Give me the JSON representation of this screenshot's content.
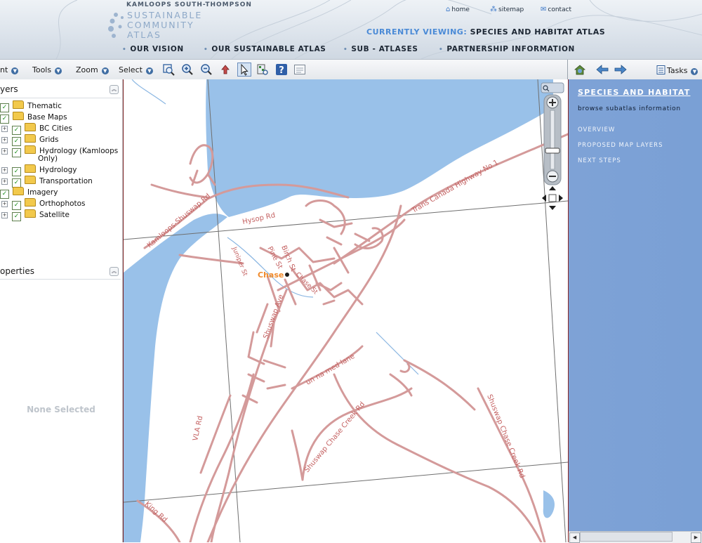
{
  "header": {
    "org": "KAMLOOPS SOUTH-THOMPSON",
    "logo_lines": [
      "SUSTAINABLE",
      "COMMUNITY",
      "ATLAS"
    ],
    "utility_links": [
      {
        "label": "home",
        "icon": "home-icon"
      },
      {
        "label": "sitemap",
        "icon": "sitemap-icon"
      },
      {
        "label": "contact",
        "icon": "envelope-icon"
      }
    ],
    "currently_viewing_label": "CURRENTLY VIEWING:",
    "currently_viewing_value": "SPECIES AND HABITAT ATLAS",
    "nav": [
      "OUR VISION",
      "OUR SUSTAINABLE ATLAS",
      "SUB - ATLASES",
      "PARTNERSHIP INFORMATION"
    ]
  },
  "toolbar": {
    "menus": [
      "nt",
      "Tools",
      "Zoom",
      "Select"
    ],
    "tools": [
      "zoom-to-extent-icon",
      "zoom-in-icon",
      "zoom-out-icon",
      "pan-icon",
      "select-pointer-icon",
      "identify-icon",
      "help-icon",
      "legend-icon"
    ],
    "right_tools": [
      "full-extent-icon",
      "back-arrow-icon",
      "forward-arrow-icon"
    ],
    "tasks_label": "Tasks"
  },
  "layers_panel": {
    "title": "yers",
    "tree": [
      {
        "label": "Thematic",
        "checked": true,
        "expandable": false
      },
      {
        "label": "Base Maps",
        "checked": true,
        "expandable": false
      },
      {
        "label": "BC Cities",
        "checked": true,
        "expandable": true
      },
      {
        "label": "Grids",
        "checked": true,
        "expandable": true
      },
      {
        "label": "Hydrology (Kamloops",
        "label2": "Only)",
        "checked": true,
        "expandable": true
      },
      {
        "label": "Hydrology",
        "checked": true,
        "expandable": true
      },
      {
        "label": "Transportation",
        "checked": true,
        "expandable": true
      },
      {
        "label": "Imagery",
        "checked": true,
        "expandable": false
      },
      {
        "label": "Orthophotos",
        "checked": true,
        "expandable": true
      },
      {
        "label": "Satellite",
        "checked": true,
        "expandable": true
      }
    ]
  },
  "properties_panel": {
    "title": "operties",
    "empty_text": "None Selected"
  },
  "map": {
    "place_label": "Chase",
    "road_labels": [
      "Trans Canada Highway No 1",
      "Kamloops-Shuswap Rd",
      "Hysop Rd",
      "Pine St",
      "Birch St",
      "Shuswap Ave",
      "Shuswap Chase Creek Rd",
      "Shuswap Chase Creek Rd",
      "un na med lane",
      "VLA Rd",
      "King Rd",
      "Juniper St",
      "Chase St"
    ],
    "colors": {
      "water": "#99c1e9",
      "road": "#d49a9a",
      "grid": "#6f6f6f",
      "place": "#f08a2c"
    }
  },
  "right_panel": {
    "title": "SPECIES AND HABITAT",
    "subtitle": "browse subatlas information",
    "links": [
      "OVERVIEW",
      "PROPOSED MAP LAYERS",
      "NEXT STEPS"
    ]
  }
}
